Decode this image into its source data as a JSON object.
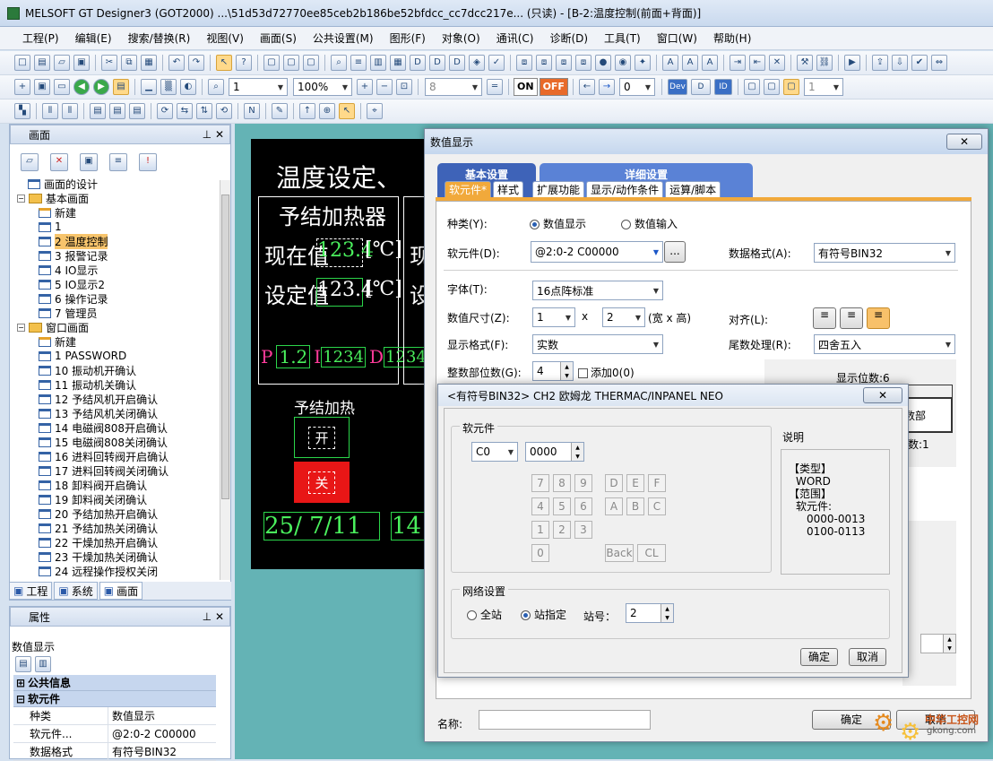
{
  "window": {
    "title": "MELSOFT GT Designer3 (GOT2000) ...\\51d53d72770ee85ceb2b186be52bfdcc_cc7dcc217e... (只读) - [B-2:温度控制(前面+背面)]"
  },
  "menu": [
    "工程(P)",
    "编辑(E)",
    "搜索/替换(R)",
    "视图(V)",
    "画面(S)",
    "公共设置(M)",
    "图形(F)",
    "对象(O)",
    "通讯(C)",
    "诊断(D)",
    "工具(T)",
    "窗口(W)",
    "帮助(H)"
  ],
  "toolbar": {
    "layer_value": "1",
    "zoom_value": "100%",
    "font_size_value": "8",
    "on_label": "ON",
    "off_label": "OFF",
    "state_value": "0",
    "dev_label": "Dev",
    "id_label": "ID",
    "last_value": "1"
  },
  "screen_panel": {
    "title": "画面",
    "tree": [
      {
        "label": "画面的设计",
        "type": "item",
        "indent": 1
      },
      {
        "label": "基本画面",
        "type": "folder",
        "indent": 0
      },
      {
        "label": "新建",
        "type": "new",
        "indent": 2
      },
      {
        "label": "1",
        "type": "item",
        "indent": 2
      },
      {
        "label": "2 温度控制",
        "type": "item",
        "indent": 2,
        "selected": true
      },
      {
        "label": "3 报警记录",
        "type": "item",
        "indent": 2
      },
      {
        "label": "4 IO显示",
        "type": "item",
        "indent": 2
      },
      {
        "label": "5 IO显示2",
        "type": "item",
        "indent": 2
      },
      {
        "label": "6 操作记录",
        "type": "item",
        "indent": 2
      },
      {
        "label": "7 管理员",
        "type": "item",
        "indent": 2
      },
      {
        "label": "窗口画面",
        "type": "folder",
        "indent": 0
      },
      {
        "label": "新建",
        "type": "new",
        "indent": 2
      },
      {
        "label": "1 PASSWORD",
        "type": "item",
        "indent": 2
      },
      {
        "label": "10 振动机开确认",
        "type": "item",
        "indent": 2
      },
      {
        "label": "11 振动机关确认",
        "type": "item",
        "indent": 2
      },
      {
        "label": "12 予结风机开启确认",
        "type": "item",
        "indent": 2
      },
      {
        "label": "13 予结风机关闭确认",
        "type": "item",
        "indent": 2
      },
      {
        "label": "14 电磁阀808开启确认",
        "type": "item",
        "indent": 2
      },
      {
        "label": "15 电磁阀808关闭确认",
        "type": "item",
        "indent": 2
      },
      {
        "label": "16 进料回转阀开启确认",
        "type": "item",
        "indent": 2
      },
      {
        "label": "17 进料回转阀关闭确认",
        "type": "item",
        "indent": 2
      },
      {
        "label": "18 卸料阀开启确认",
        "type": "item",
        "indent": 2
      },
      {
        "label": "19 卸料阀关闭确认",
        "type": "item",
        "indent": 2
      },
      {
        "label": "20 予结加热开启确认",
        "type": "item",
        "indent": 2
      },
      {
        "label": "21 予结加热关闭确认",
        "type": "item",
        "indent": 2
      },
      {
        "label": "22 干燥加热开启确认",
        "type": "item",
        "indent": 2
      },
      {
        "label": "23 干燥加热关闭确认",
        "type": "item",
        "indent": 2
      },
      {
        "label": "24 远程操作授权关闭",
        "type": "item",
        "indent": 2
      }
    ],
    "tabs": [
      "工程",
      "系统",
      "画面"
    ]
  },
  "properties_panel": {
    "title": "属性",
    "object_name": "数值显示",
    "group_common": "公共信息",
    "group_device": "软元件",
    "rows": [
      {
        "key": "种类",
        "value": "数值显示"
      },
      {
        "key": "软元件...",
        "value": "@2:0-2 C00000"
      },
      {
        "key": "数据格式",
        "value": "有符号BIN32"
      }
    ]
  },
  "hmi_screen": {
    "title": "温度设定、",
    "heater_title": "予结加热器",
    "current_label": "现在值",
    "current_value": "123.4",
    "unit": "[℃]",
    "set_label": "设定值",
    "set_value": "123.4",
    "pid_p": "P",
    "pid_p_val": "1.2",
    "pid_i": "I",
    "pid_i_val": "1234",
    "pid_d": "D",
    "pid_d_val": "1234",
    "heat_label": "予结加热",
    "on_btn": "开",
    "off_btn": "关",
    "date": "25/ 7/11",
    "time_part": "14",
    "current_label2": "现",
    "set_label2": "设"
  },
  "dialog_main": {
    "title": "数值显示",
    "tab_basic": "基本设置",
    "tab_detail": "详细设置",
    "subtabs": [
      "软元件*",
      "样式",
      "扩展功能",
      "显示/动作条件",
      "运算/脚本"
    ],
    "type_label": "种类(Y):",
    "type_display": "数值显示",
    "type_input": "数值输入",
    "device_label": "软元件(D):",
    "device_value": "@2:0-2 C00000",
    "browse": "...",
    "data_format_label": "数据格式(A):",
    "data_format_value": "有符号BIN32",
    "font_label": "字体(T):",
    "font_value": "16点阵标准",
    "size_label": "数值尺寸(Z):",
    "size_w": "1",
    "size_x": "x",
    "size_h": "2",
    "size_unit": "(宽 x 高)",
    "align_label": "对齐(L):",
    "display_format_label": "显示格式(F):",
    "display_format_value": "实数",
    "round_label": "尾数处理(R):",
    "round_value": "四舍五入",
    "int_digits_label": "整数部位数(G):",
    "int_digits_value": "4",
    "add_zero": "添加0(0)",
    "digits_label": "显示位数:6",
    "decimal_label": "数部",
    "decimal_count": "数:1",
    "name_label": "名称:",
    "ok": "确定",
    "cancel": "取消"
  },
  "dialog_device": {
    "title": "<有符号BIN32> CH2 欧姆龙 THERMAC/INPANEL NEO",
    "device_group": "软元件",
    "device_code": "C0",
    "device_number": "0000",
    "keys_num": [
      "7",
      "8",
      "9",
      "4",
      "5",
      "6",
      "1",
      "2",
      "3",
      "0"
    ],
    "keys_hex": [
      "D",
      "E",
      "F",
      "A",
      "B",
      "C"
    ],
    "key_back": "Back",
    "key_clear": "CL",
    "desc_title": "说明",
    "desc_lines": [
      "【类型】",
      "WORD",
      "【范围】",
      "软元件:",
      "0000-0013",
      "0100-0113"
    ],
    "network_group": "网络设置",
    "all_station": "全站",
    "specify_station": "站指定",
    "station_label": "站号：",
    "station_value": "2",
    "ok": "确定",
    "cancel": "取消"
  },
  "watermark": {
    "text": "中华工控网",
    "url": "gkong.com"
  }
}
